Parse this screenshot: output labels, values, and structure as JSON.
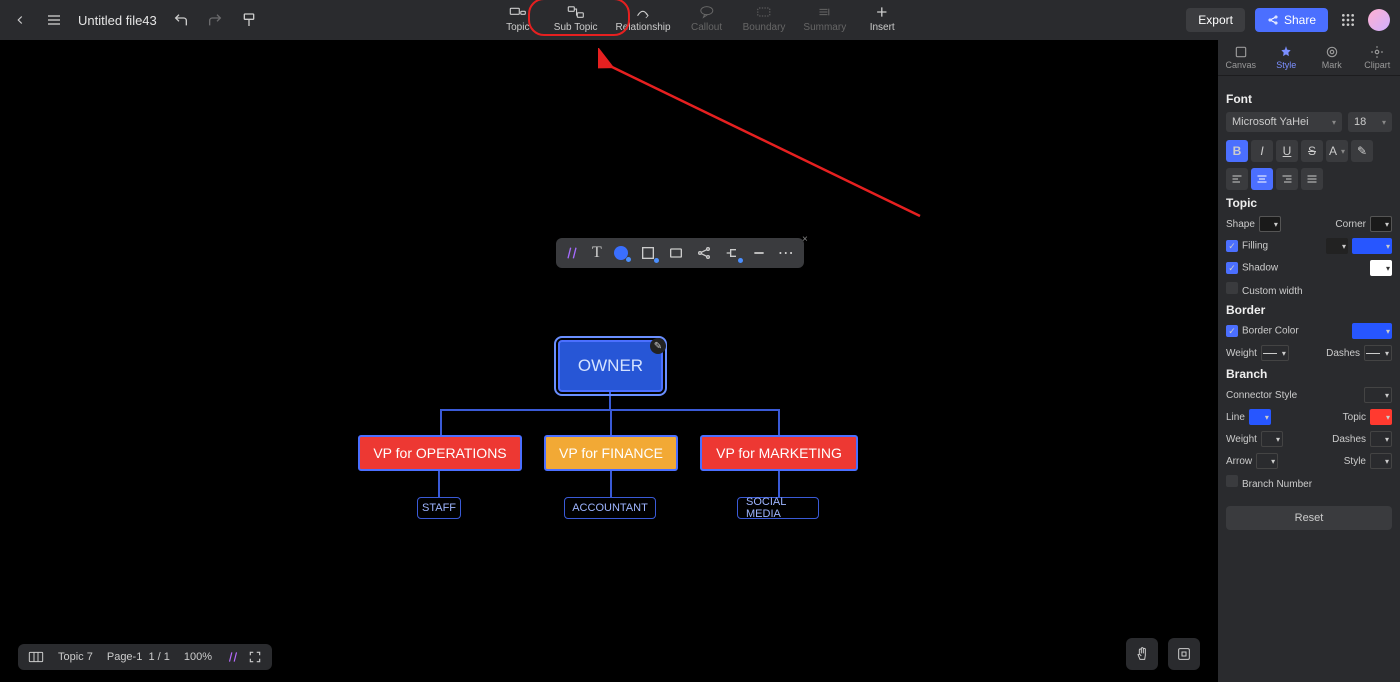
{
  "header": {
    "filename": "Untitled file43",
    "tools": [
      {
        "key": "topic",
        "label": "Topic"
      },
      {
        "key": "subtopic",
        "label": "Sub Topic"
      },
      {
        "key": "relationship",
        "label": "Relationship"
      },
      {
        "key": "callout",
        "label": "Callout"
      },
      {
        "key": "boundary",
        "label": "Boundary"
      },
      {
        "key": "summary",
        "label": "Summary"
      },
      {
        "key": "insert",
        "label": "Insert"
      }
    ],
    "export": "Export",
    "share": "Share"
  },
  "sidepanel": {
    "tabs": [
      "Canvas",
      "Style",
      "Mark",
      "Clipart"
    ],
    "active_tab": "Style",
    "font": {
      "title": "Font",
      "family": "Microsoft YaHei",
      "size": "18"
    },
    "topic": {
      "title": "Topic",
      "shape": "Shape",
      "corner": "Corner",
      "filling": "Filling",
      "filling_color": "#2756ff",
      "shadow": "Shadow",
      "shadow_color": "#ffffff",
      "custom_width": "Custom width"
    },
    "border": {
      "title": "Border",
      "color_label": "Border Color",
      "color": "#2756ff",
      "weight": "Weight",
      "dashes": "Dashes"
    },
    "branch": {
      "title": "Branch",
      "connector": "Connector Style",
      "line": "Line",
      "line_color": "#2756ff",
      "topic": "Topic",
      "topic_color": "#ff3a2f",
      "weight": "Weight",
      "dashes": "Dashes",
      "arrow": "Arrow",
      "style": "Style",
      "branch_number": "Branch Number"
    },
    "reset": "Reset"
  },
  "mindmap": {
    "root": "OWNER",
    "level2": [
      "VP for OPERATIONS",
      "VP for FINANCE",
      "VP for MARKETING"
    ],
    "level3": [
      "STAFF",
      "ACCOUNTANT",
      "SOCIAL MEDIA"
    ]
  },
  "bottom": {
    "topic": "Topic 7",
    "page": "Page-1",
    "page_count": "1 / 1",
    "zoom": "100%"
  }
}
